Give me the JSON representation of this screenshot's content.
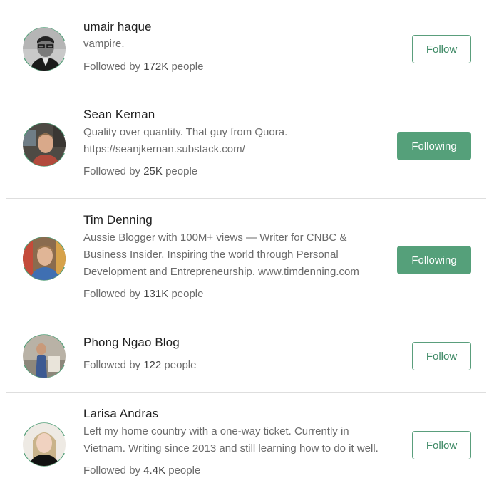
{
  "accent_color": "#55a07a",
  "followed_prefix": "Followed by",
  "followed_suffix": "people",
  "people": [
    {
      "name": "umair haque",
      "bio": [
        "vampire."
      ],
      "followers": "172K",
      "button": "Follow"
    },
    {
      "name": "Sean Kernan",
      "bio": [
        "Quality over quantity. That guy from Quora.",
        "https://seanjkernan.substack.com/"
      ],
      "followers": "25K",
      "button": "Following"
    },
    {
      "name": "Tim Denning",
      "bio": [
        "Aussie Blogger with 100M+ views — Writer for CNBC &",
        "Business Insider. Inspiring the world through Personal",
        "Development and Entrepreneurship. www.timdenning.com"
      ],
      "followers": "131K",
      "button": "Following"
    },
    {
      "name": "Phong Ngao Blog",
      "bio": [],
      "followers": "122",
      "button": "Follow"
    },
    {
      "name": "Larisa Andras",
      "bio": [
        "Left my home country with a one-way ticket. Currently in",
        "Vietnam. Writing since 2013 and still learning how to do it well."
      ],
      "followers": "4.4K",
      "button": "Follow"
    }
  ]
}
